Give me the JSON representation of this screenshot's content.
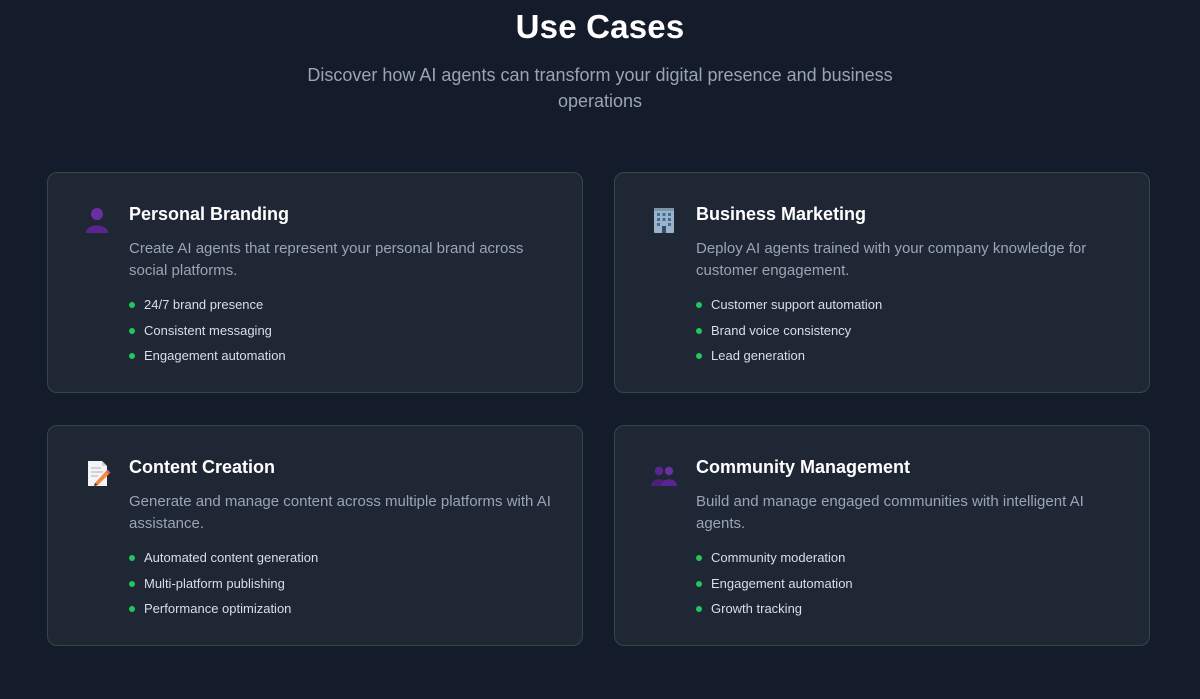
{
  "header": {
    "title": "Use Cases",
    "subtitle": "Discover how AI agents can transform your digital presence and business operations"
  },
  "accent_color": "#22c55e",
  "cards": [
    {
      "icon": "person-silhouette-icon",
      "title": "Personal Branding",
      "description": "Create AI agents that represent your personal brand across social platforms.",
      "features": [
        "24/7 brand presence",
        "Consistent messaging",
        "Engagement automation"
      ]
    },
    {
      "icon": "office-building-icon",
      "title": "Business Marketing",
      "description": "Deploy AI agents trained with your company knowledge for customer engagement.",
      "features": [
        "Customer support automation",
        "Brand voice consistency",
        "Lead generation"
      ]
    },
    {
      "icon": "memo-pencil-icon",
      "title": "Content Creation",
      "description": "Generate and manage content across multiple platforms with AI assistance.",
      "features": [
        "Automated content generation",
        "Multi-platform publishing",
        "Performance optimization"
      ]
    },
    {
      "icon": "people-silhouettes-icon",
      "title": "Community Management",
      "description": "Build and manage engaged communities with intelligent AI agents.",
      "features": [
        "Community moderation",
        "Engagement automation",
        "Growth tracking"
      ]
    }
  ]
}
